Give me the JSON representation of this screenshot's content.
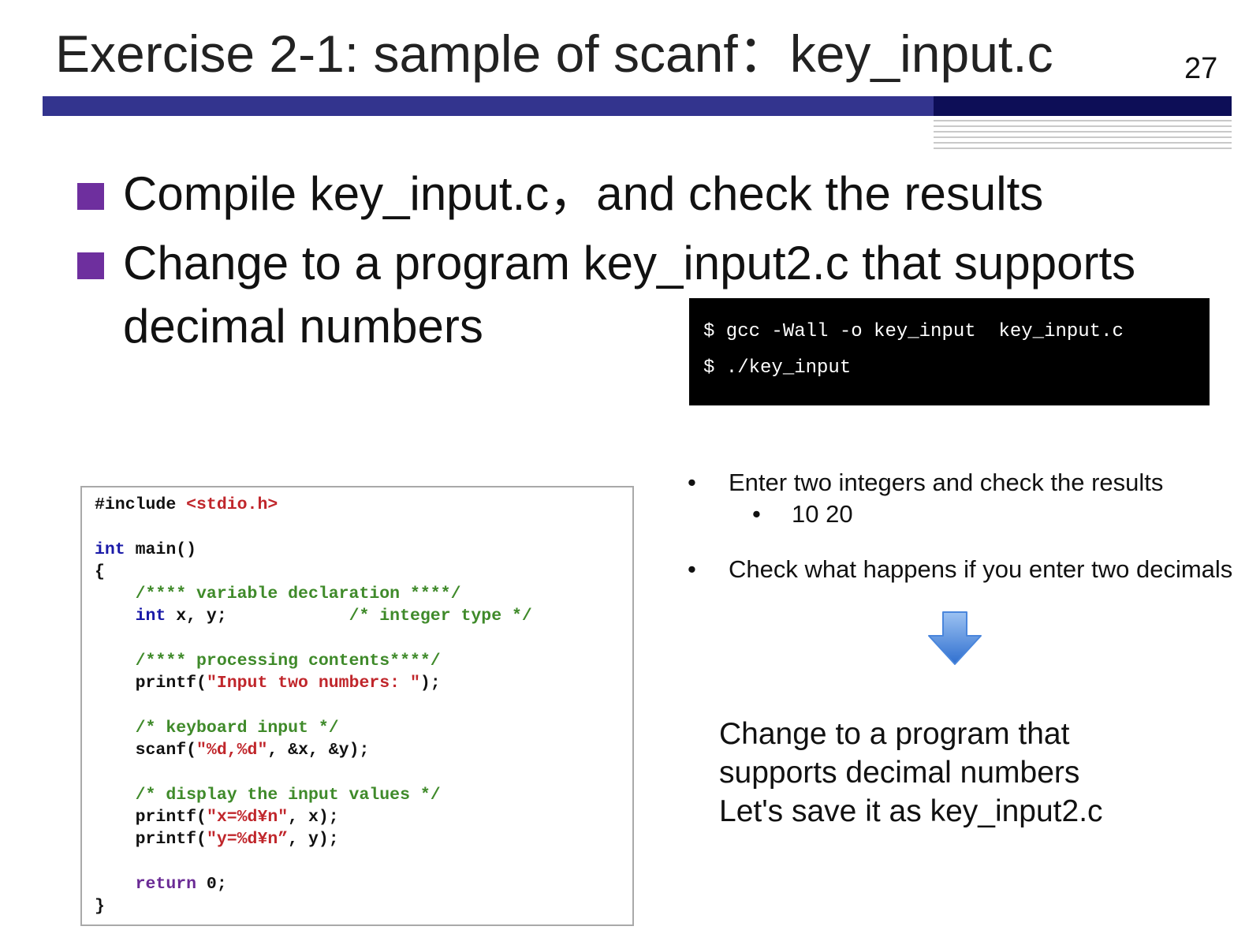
{
  "slide": {
    "title": "Exercise 2-1: sample of scanf：key_input.c",
    "page_number": "27"
  },
  "bullets": [
    {
      "text": "Compile key_input.c，and check the results"
    },
    {
      "line1": "Change to a program key_input2.c that supports",
      "line2": "decimal numbers"
    }
  ],
  "terminal": {
    "lines": [
      "$ gcc -Wall -o key_input  key_input.c",
      "$ ./key_input"
    ]
  },
  "code": {
    "include_directive": "#include",
    "include_header": "<stdio.h>",
    "int_kw": "int",
    "main_sig": " main()",
    "open_brace": "{",
    "comment_decl": "/**** variable declaration ****/",
    "int_kw2": "int",
    "vars": " x, y;",
    "comment_int": "/* integer type */",
    "comment_processing": "/**** processing contents****/",
    "printf1_fn": "printf(",
    "printf1_str": "\"Input two numbers: \"",
    "printf1_end": ");",
    "comment_keyboard": "/* keyboard input */",
    "scanf_fn": "scanf(",
    "scanf_str": "\"%d,%d\"",
    "scanf_args": ", &x, &y);",
    "comment_display": "/* display the input values */",
    "printf2_fn": "printf(",
    "printf2_str": "\"x=%d¥n\"",
    "printf2_args": ", x);",
    "printf3_fn": "printf(",
    "printf3_str": "\"y=%d¥n”",
    "printf3_args": ", y);",
    "return_kw": "return",
    "return_val": " 0;",
    "close_brace": "}"
  },
  "notes": {
    "bullet_char": "•",
    "item1": "Enter two integers and check the results",
    "item1_sub": "10 20",
    "item2": "Check what happens if you enter two decimals"
  },
  "conclusion": {
    "line1": "Change to a program that",
    "line2": "supports decimal numbers",
    "line3": "Let's save it as key_input2.c"
  },
  "colors": {
    "title_bar": "#33348e",
    "title_bar_dark": "#0d0e57",
    "bullet_square": "#6e2f9e",
    "keyword": "#1a1aa8",
    "string": "#c0262b",
    "comment": "#3f8a2a",
    "arrow": "#4a86dc"
  },
  "icons": {
    "down_arrow": "down-arrow-icon"
  }
}
